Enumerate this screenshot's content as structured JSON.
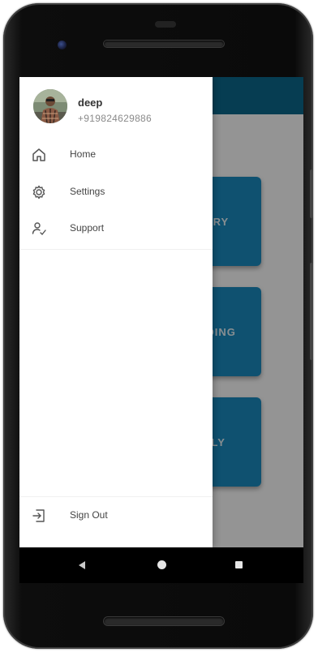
{
  "cards": [
    {
      "label": "LERY"
    },
    {
      "label": "DDING"
    },
    {
      "label": "MILY"
    }
  ],
  "drawer": {
    "user_name": "deep",
    "user_phone": "+919824629886",
    "menu": [
      {
        "label": "Home",
        "icon": "home-icon"
      },
      {
        "label": "Settings",
        "icon": "gear-icon"
      },
      {
        "label": "Support",
        "icon": "user-check-icon"
      }
    ],
    "sign_out": {
      "label": "Sign Out",
      "icon": "sign-out-icon"
    }
  },
  "colors": {
    "app_bar": "#0b6a8e",
    "card": "#1a8cc2",
    "drawer_bg": "#ffffff"
  },
  "navbar": {
    "back": "back-icon",
    "home": "home-circle-icon",
    "recents": "recents-icon"
  }
}
